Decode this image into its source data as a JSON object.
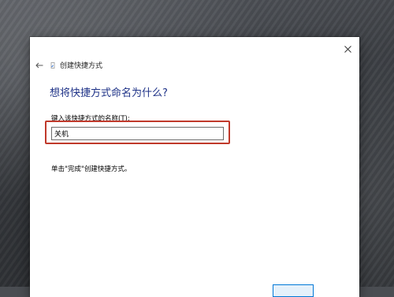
{
  "dialog": {
    "title": "创建快捷方式",
    "heading": "想将快捷方式命名为什么?",
    "field_label": "键入该快捷方式的名称(T):",
    "name_value": "关机",
    "hint": "单击\"完成\"创建快捷方式。"
  },
  "icons": {
    "back": "back-arrow-icon",
    "close": "close-icon",
    "title": "shortcut-icon"
  },
  "colors": {
    "heading": "#1e3287",
    "highlight_frame": "#c0392b",
    "button_border": "#0078d7"
  }
}
